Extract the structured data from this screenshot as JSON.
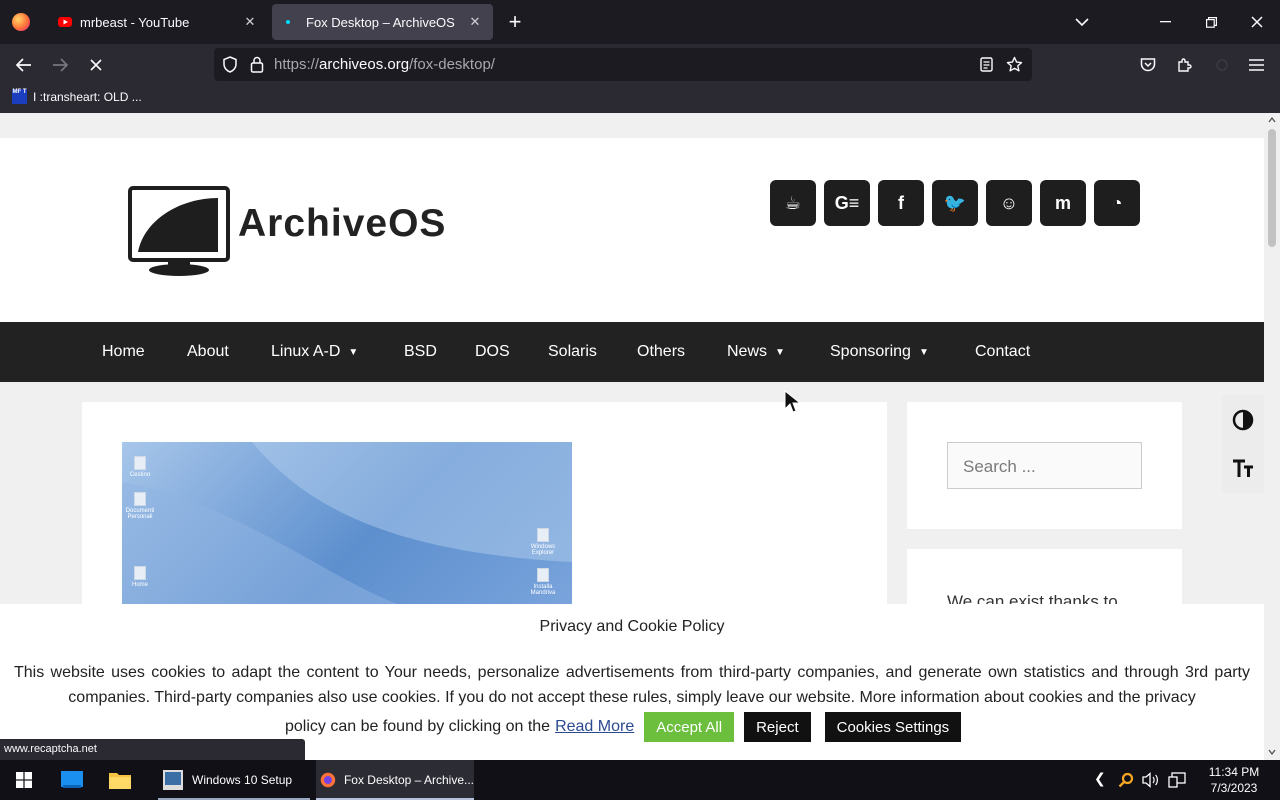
{
  "browser": {
    "tabs": [
      {
        "title": "mrbeast - YouTube",
        "close": "✕"
      },
      {
        "title": "Fox Desktop – ArchiveOS",
        "close": "✕"
      }
    ],
    "new_tab": "+",
    "url": {
      "scheme": "https://",
      "domain": "archiveos.org",
      "path": "/fox-desktop/"
    },
    "bookmarks": [
      {
        "label": "I :transheart: OLD ...",
        "icon_text": "MF T"
      }
    ],
    "status_url": "www.recaptcha.net"
  },
  "site": {
    "logo_text": "ArchiveOS",
    "social_icons": [
      "kofi-icon",
      "gettr-icon",
      "facebook-icon",
      "twitter-icon",
      "reddit-icon",
      "mastodon-icon",
      "rss-icon"
    ],
    "social_glyphs": [
      "☕",
      "G≡",
      "f",
      "🐦",
      "☺",
      "m",
      "◔"
    ],
    "nav": [
      {
        "label": "Home",
        "has_menu": false
      },
      {
        "label": "About",
        "has_menu": false
      },
      {
        "label": "Linux A-D",
        "has_menu": true
      },
      {
        "label": "BSD",
        "has_menu": false
      },
      {
        "label": "DOS",
        "has_menu": false
      },
      {
        "label": "Solaris",
        "has_menu": false
      },
      {
        "label": "Others",
        "has_menu": false
      },
      {
        "label": "News",
        "has_menu": true
      },
      {
        "label": "Sponsoring",
        "has_menu": true
      },
      {
        "label": "Contact",
        "has_menu": false
      }
    ],
    "search_placeholder": "Search ...",
    "widget_text": "We can exist thanks to",
    "desktop_icons": [
      "Cestino",
      "Documenti Personali",
      "Home",
      "Windows Explorer",
      "Installa Mandriva"
    ]
  },
  "cookie": {
    "title": "Privacy and Cookie Policy",
    "text": "This website uses cookies to adapt the content to Your needs, personalize advertisements from third-party companies, and generate own statistics and through 3rd party companies. Third-party companies also use cookies. If you do not accept these rules, simply leave our website. More information about cookies and the privacy",
    "text_end": "policy can be found by clicking on the",
    "read_more": "Read More",
    "accept": "Accept All",
    "reject": "Reject",
    "settings": "Cookies Settings"
  },
  "taskbar": {
    "apps": [
      {
        "label": "Windows 10 Setup"
      },
      {
        "label": "Fox Desktop – Archive..."
      }
    ],
    "time": "11:34 PM",
    "date": "7/3/2023"
  },
  "colors": {
    "tab_active": "#42414d",
    "nav_bg": "#222222",
    "accept_green": "#6bbf3d"
  }
}
